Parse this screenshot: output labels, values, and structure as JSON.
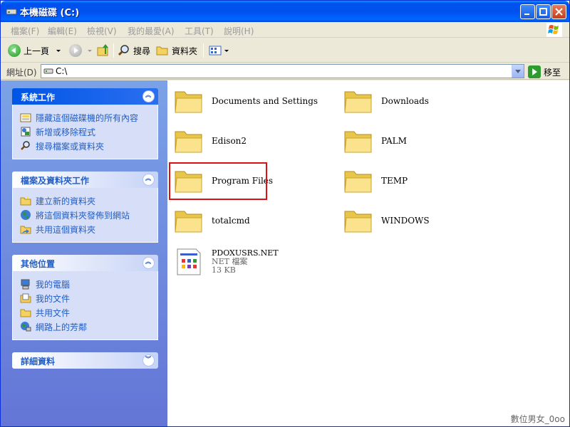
{
  "window": {
    "title": "本機磁碟 (C:)"
  },
  "menu": {
    "items": [
      {
        "label": "檔案(F)"
      },
      {
        "label": "編輯(E)"
      },
      {
        "label": "檢視(V)"
      },
      {
        "label": "我的最愛(A)"
      },
      {
        "label": "工具(T)"
      },
      {
        "label": "說明(H)"
      }
    ]
  },
  "toolbar": {
    "back_label": "上一頁",
    "search_label": "搜尋",
    "folders_label": "資料夾"
  },
  "address": {
    "label": "網址(D)",
    "value": "C:\\",
    "go_label": "移至"
  },
  "taskpane": {
    "system": {
      "title": "系統工作",
      "items": [
        {
          "label": "隱藏這個磁碟機的所有內容"
        },
        {
          "label": "新增或移除程式"
        },
        {
          "label": "搜尋檔案或資料夾"
        }
      ]
    },
    "file_folder": {
      "title": "檔案及資料夾工作",
      "items": [
        {
          "label": "建立新的資料夾"
        },
        {
          "label": "將這個資料夾發佈到網站"
        },
        {
          "label": "共用這個資料夾"
        }
      ]
    },
    "other_places": {
      "title": "其他位置",
      "items": [
        {
          "label": "我的電腦"
        },
        {
          "label": "我的文件"
        },
        {
          "label": "共用文件"
        },
        {
          "label": "網路上的芳鄰"
        }
      ]
    },
    "details": {
      "title": "詳細資料"
    }
  },
  "content": {
    "folders": [
      {
        "name": "Documents and Settings"
      },
      {
        "name": "Downloads"
      },
      {
        "name": "Edison2"
      },
      {
        "name": "PALM"
      },
      {
        "name": "Program Files"
      },
      {
        "name": "TEMP"
      },
      {
        "name": "totalcmd"
      },
      {
        "name": "WINDOWS"
      }
    ],
    "file": {
      "name": "PDOXUSRS.NET",
      "type": "NET 檔案",
      "size": "13 KB"
    }
  },
  "watermark": "數位男女_0oo"
}
